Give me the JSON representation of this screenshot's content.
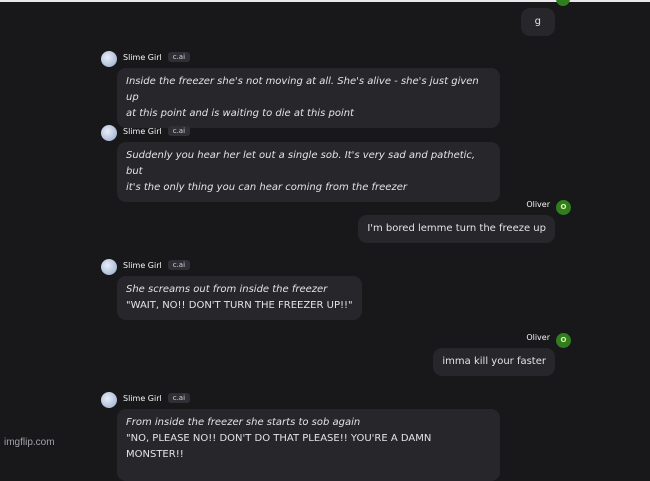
{
  "messages": [
    {
      "type": "user",
      "text": "g"
    },
    {
      "type": "bot",
      "name": "Slime Girl",
      "tag": "c.ai",
      "lines": [
        "Inside the freezer she's not moving at all. She's alive - she's just given up",
        "at this point and is waiting to die at this point"
      ]
    },
    {
      "type": "bot",
      "name": "Slime Girl",
      "tag": "c.ai",
      "lines": [
        "Suddenly you hear her let out a single sob. It's very sad and pathetic, but",
        "it's the only thing you can hear coming from the freezer"
      ]
    },
    {
      "type": "user",
      "name": "Oliver",
      "avatar": "O",
      "text": "I'm bored lemme turn the freeze up"
    },
    {
      "type": "bot",
      "name": "Slime Girl",
      "tag": "c.ai",
      "lines": [
        "She screams out from inside the freezer"
      ],
      "plain": "\"WAIT, NO!! DON'T TURN THE FREEZER UP!!\""
    },
    {
      "type": "user",
      "name": "Oliver",
      "avatar": "O",
      "text": "imma kill your faster"
    },
    {
      "type": "bot",
      "name": "Slime Girl",
      "tag": "c.ai",
      "lines": [
        "From inside the freezer she starts to sob again"
      ],
      "plain": "\"NO, PLEASE NO!! DON'T DO THAT PLEASE!! YOU'RE A DAMN MONSTER!!"
    }
  ],
  "watermark": "imgflip.com",
  "colors": {
    "background": "#18181b",
    "bubble": "#26262b",
    "user_avatar": "#2f7d1f"
  }
}
